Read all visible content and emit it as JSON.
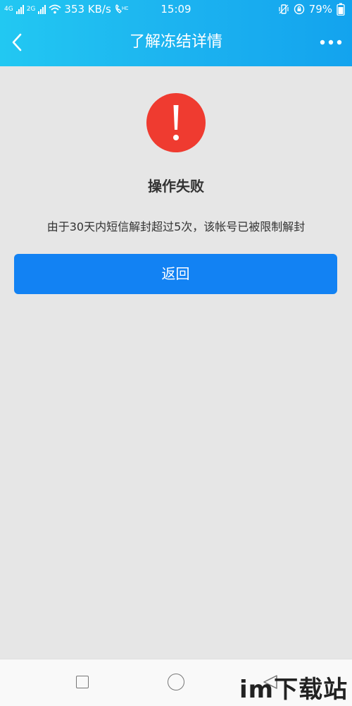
{
  "status_bar": {
    "network_a": "4G",
    "network_b": "2G",
    "speed": "353 KB/s",
    "hd": "HD",
    "time": "15:09",
    "battery": "79%"
  },
  "header": {
    "title": "了解冻结详情",
    "back_icon": "chevron-left-icon",
    "more_icon": "more-dots-icon",
    "background_start": "#22c8f2",
    "background_end": "#13a3ee"
  },
  "result": {
    "icon": "exclamation-circle-icon",
    "icon_color": "#ef3b30",
    "title": "操作失败",
    "message": "由于30天内短信解封超过5次，该帐号已被限制解封"
  },
  "actions": {
    "return_label": "返回",
    "button_color": "#1282f3"
  },
  "nav_bar": {
    "recent_icon": "square-icon",
    "home_icon": "circle-icon",
    "back_icon": "triangle-back-icon"
  },
  "watermark": {
    "text": "im下载站"
  }
}
